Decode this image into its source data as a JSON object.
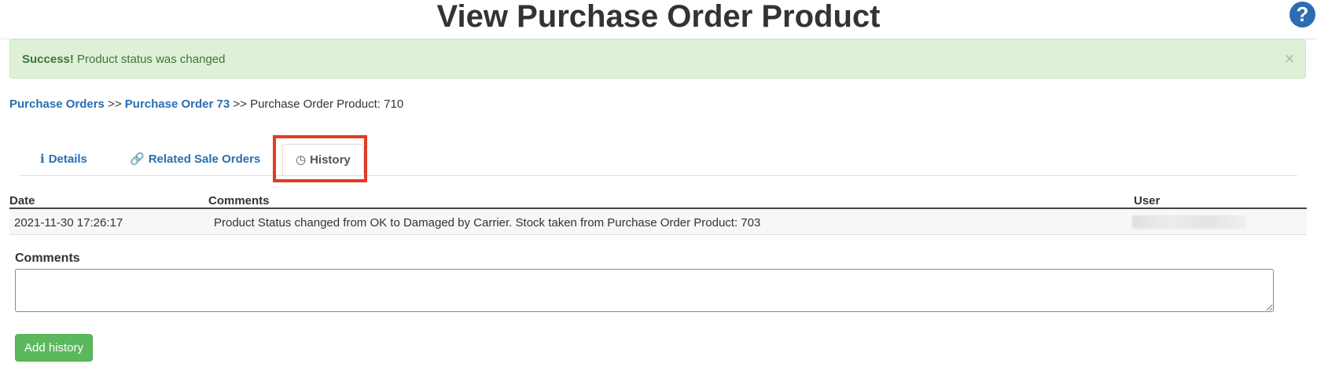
{
  "header": {
    "title": "View Purchase Order Product",
    "help_label": "?"
  },
  "alert": {
    "strong": "Success!",
    "message": " Product status was changed",
    "close_label": "×"
  },
  "breadcrumb": {
    "items": [
      {
        "label": "Purchase Orders",
        "link": true
      },
      {
        "label": "Purchase Order 73",
        "link": true
      },
      {
        "label": "Purchase Order Product: 710",
        "link": false
      }
    ],
    "separator": ">>"
  },
  "tabs": [
    {
      "icon": "info-icon",
      "glyph": "ℹ",
      "label": "Details",
      "active": false
    },
    {
      "icon": "link-icon",
      "glyph": "🔗",
      "label": "Related Sale Orders",
      "active": false
    },
    {
      "icon": "clock-icon",
      "glyph": "◷",
      "label": "History",
      "active": true
    }
  ],
  "history_table": {
    "columns": [
      "Date",
      "Comments",
      "User"
    ],
    "rows": [
      {
        "date": "2021-11-30 17:26:17",
        "comments": "Product Status changed from OK to Damaged by Carrier. Stock taken from Purchase Order Product: 703",
        "user": ""
      }
    ]
  },
  "form": {
    "comments_label": "Comments",
    "comments_value": "",
    "submit_label": "Add history"
  },
  "colors": {
    "link": "#2a6db2",
    "success_bg": "#dff0d8",
    "success_text": "#3c763d",
    "button": "#5cb85c",
    "highlight": "#e23c22"
  }
}
